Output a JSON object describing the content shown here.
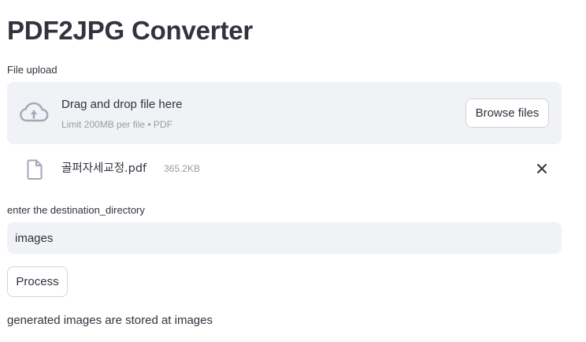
{
  "page": {
    "title": "PDF2JPG Converter"
  },
  "file_uploader": {
    "label": "File upload",
    "dropzone_text": "Drag and drop file here",
    "limit_text": "Limit 200MB per file • PDF",
    "browse_label": "Browse files",
    "icon": "cloud-upload-icon"
  },
  "uploaded_file": {
    "name": "골퍼자세교정.pdf",
    "size": "365.2KB",
    "icon": "file-icon",
    "remove_icon": "close-icon"
  },
  "destination": {
    "label": "enter the destination_directory",
    "value": "images"
  },
  "process_button": {
    "label": "Process"
  },
  "status": {
    "message": "generated images are stored at images"
  },
  "colors": {
    "text": "#31333f",
    "muted": "#9a9ca3",
    "input_background": "#f0f2f6",
    "button_border": "#d3d4d8"
  }
}
